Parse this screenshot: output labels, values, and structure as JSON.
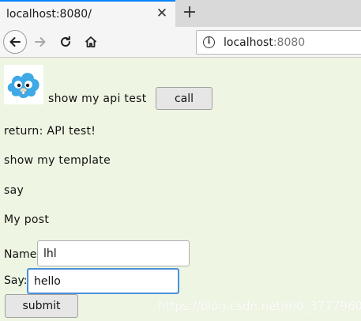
{
  "tab": {
    "title": "localhost:8080/",
    "close_icon": "close-icon",
    "new_tab_icon": "plus-icon"
  },
  "navigation": {
    "back_icon": "arrow-left-icon",
    "forward_icon": "arrow-right-icon",
    "reload_icon": "reload-icon",
    "home_icon": "home-icon"
  },
  "address_bar": {
    "info_icon": "info-icon",
    "host": "localhost",
    "port": ":8080"
  },
  "page": {
    "logo_icon": "cloud-mascot-icon",
    "api_text": "show my api test",
    "call_button": "call",
    "return_text": "return: API test!",
    "template_text": "show my template",
    "say_text": "say",
    "post_text": "My post",
    "name_label": "Name:",
    "name_value": "lhl",
    "say_label": "Say:",
    "say_value": "hello",
    "submit_button": "submit",
    "watermark": "https://blog.csdn.net/m0_37779608"
  },
  "colors": {
    "accent": "#0a84ff",
    "page_background": "#eef6e3",
    "focus_border": "#4a90d9",
    "logo_blue": "#3fa9e6"
  }
}
